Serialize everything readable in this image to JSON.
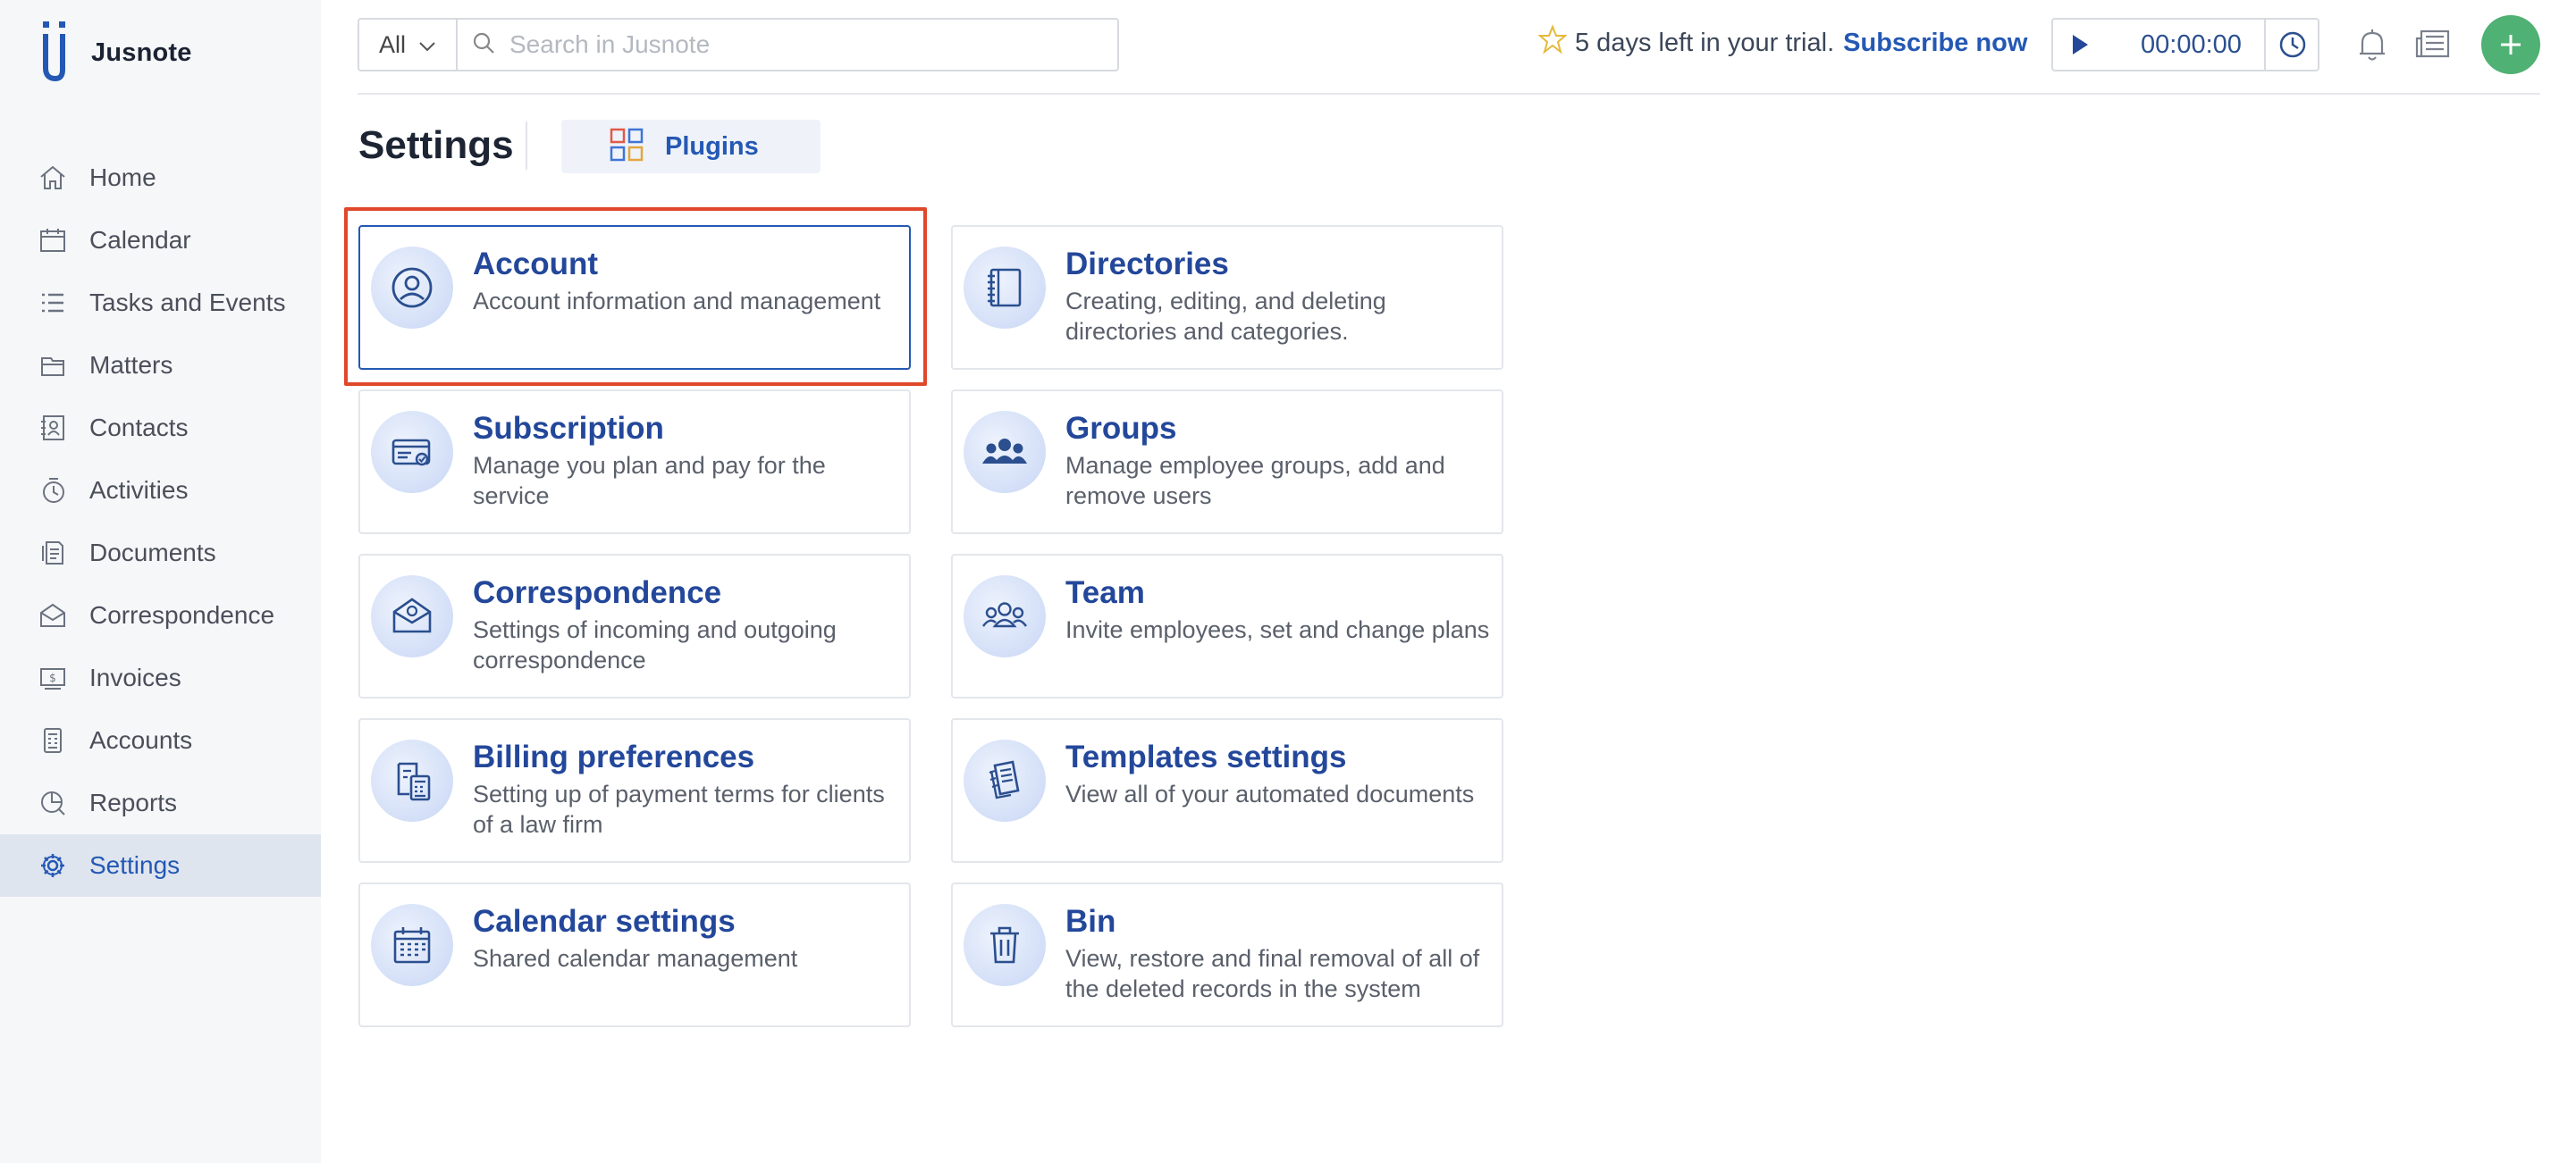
{
  "app": {
    "name": "Jusnote"
  },
  "sidebar": {
    "items": [
      {
        "label": "Home",
        "icon": "home-icon"
      },
      {
        "label": "Calendar",
        "icon": "calendar-icon"
      },
      {
        "label": "Tasks and Events",
        "icon": "tasks-icon"
      },
      {
        "label": "Matters",
        "icon": "matters-icon"
      },
      {
        "label": "Contacts",
        "icon": "contacts-icon"
      },
      {
        "label": "Activities",
        "icon": "activities-icon"
      },
      {
        "label": "Documents",
        "icon": "documents-icon"
      },
      {
        "label": "Correspondence",
        "icon": "correspondence-icon"
      },
      {
        "label": "Invoices",
        "icon": "invoices-icon"
      },
      {
        "label": "Accounts",
        "icon": "accounts-icon"
      },
      {
        "label": "Reports",
        "icon": "reports-icon"
      },
      {
        "label": "Settings",
        "icon": "settings-icon",
        "active": true
      }
    ]
  },
  "topbar": {
    "scope": "All",
    "search_placeholder": "Search in Jusnote",
    "trial_text": "5 days left in your trial.",
    "subscribe_label": "Subscribe now",
    "timer": "00:00:00"
  },
  "header": {
    "title": "Settings",
    "plugins_label": "Plugins"
  },
  "cards": [
    {
      "title": "Account",
      "description": "Account information and management",
      "icon": "account-icon",
      "selected": true
    },
    {
      "title": "Directories",
      "description": "Creating, editing, and deleting directories and categories.",
      "icon": "directories-icon"
    },
    {
      "title": "Subscription",
      "description": "Manage you plan and pay for the service",
      "icon": "subscription-icon"
    },
    {
      "title": "Groups",
      "description": "Manage employee groups, add and remove users",
      "icon": "groups-icon"
    },
    {
      "title": "Correspondence",
      "description": "Settings of incoming and outgoing correspondence",
      "icon": "correspondence-icon"
    },
    {
      "title": "Team",
      "description": "Invite employees, set and change plans",
      "icon": "team-icon"
    },
    {
      "title": "Billing preferences",
      "description": "Setting up of payment terms for clients of a law firm",
      "icon": "billing-icon"
    },
    {
      "title": "Templates settings",
      "description": "View all of your automated documents",
      "icon": "templates-icon"
    },
    {
      "title": "Calendar settings",
      "description": "Shared calendar management",
      "icon": "calendar-settings-icon"
    },
    {
      "title": "Bin",
      "description": "View, restore and final removal of all of the deleted records in the system",
      "icon": "bin-icon"
    }
  ],
  "colors": {
    "accent": "#2458b4",
    "highlight": "#e0472b",
    "add_button": "#4fb173"
  }
}
